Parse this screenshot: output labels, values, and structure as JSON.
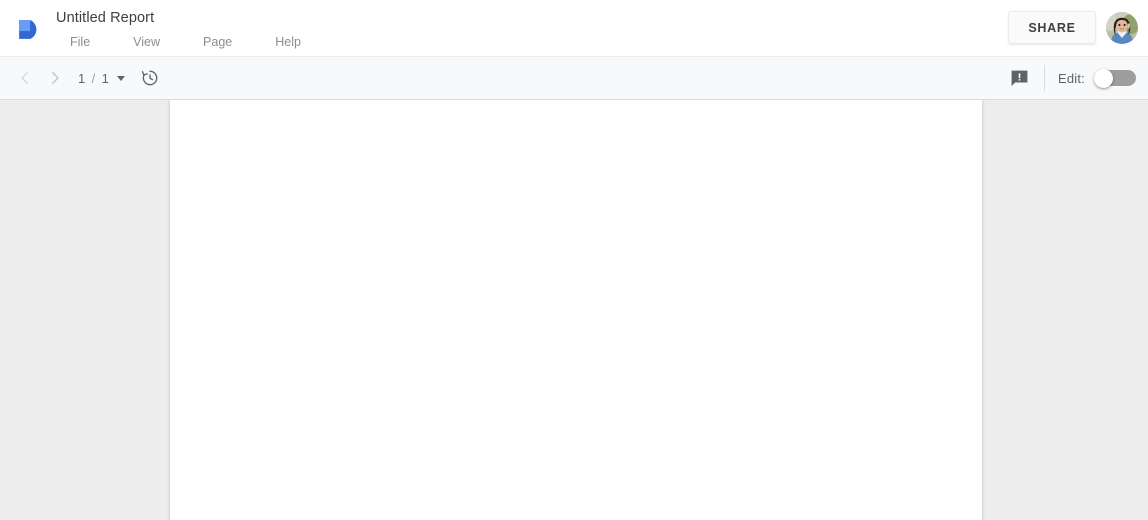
{
  "app": {
    "product_logo": "data-studio-logo",
    "brand_color_light": "#669df6",
    "brand_color_dark": "#3367d6"
  },
  "header": {
    "title": "Untitled Report",
    "menu": [
      {
        "label": "File",
        "name": "menu-file"
      },
      {
        "label": "View",
        "name": "menu-view"
      },
      {
        "label": "Page",
        "name": "menu-page"
      },
      {
        "label": "Help",
        "name": "menu-help"
      }
    ],
    "share_label": "SHARE",
    "avatar_alt": "user-avatar"
  },
  "toolbar": {
    "prev_page_icon": "chevron-left-icon",
    "next_page_icon": "chevron-right-icon",
    "current_page": "1",
    "page_separator": "/",
    "total_pages": "1",
    "page_dropdown_icon": "chevron-down-icon",
    "history_icon": "version-history-icon",
    "feedback_icon": "feedback-icon",
    "edit_label": "Edit:",
    "edit_toggle_state": "off"
  },
  "canvas": {
    "page_background": "#ffffff",
    "workspace_background": "#ededed"
  }
}
